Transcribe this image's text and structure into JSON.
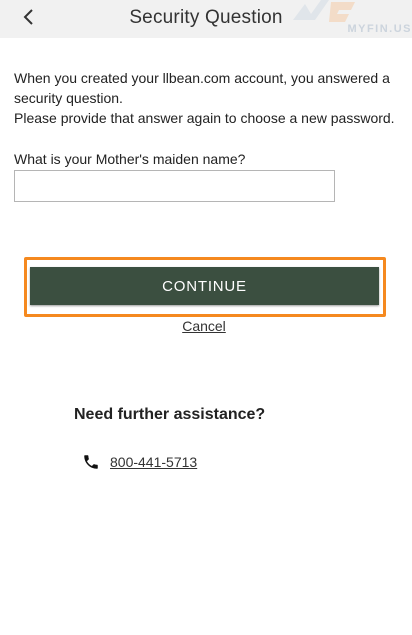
{
  "header": {
    "title": "Security Question",
    "back_icon": "chevron-left-icon"
  },
  "watermark": {
    "text": "MYFIN.US"
  },
  "intro": {
    "line1": "When you created your llbean.com account, you answered a",
    "line2": "security question.",
    "line3": "Please provide that answer again to choose a new password."
  },
  "question": {
    "label": "What is your Mother's maiden name?",
    "value": "",
    "placeholder": ""
  },
  "actions": {
    "continue_label": "CONTINUE",
    "cancel_label": "Cancel",
    "continue_color": "#3b4f40",
    "highlight_color": "#f5891f"
  },
  "assistance": {
    "heading": "Need further assistance?",
    "phone": "800-441-5713",
    "phone_icon": "phone-icon"
  }
}
